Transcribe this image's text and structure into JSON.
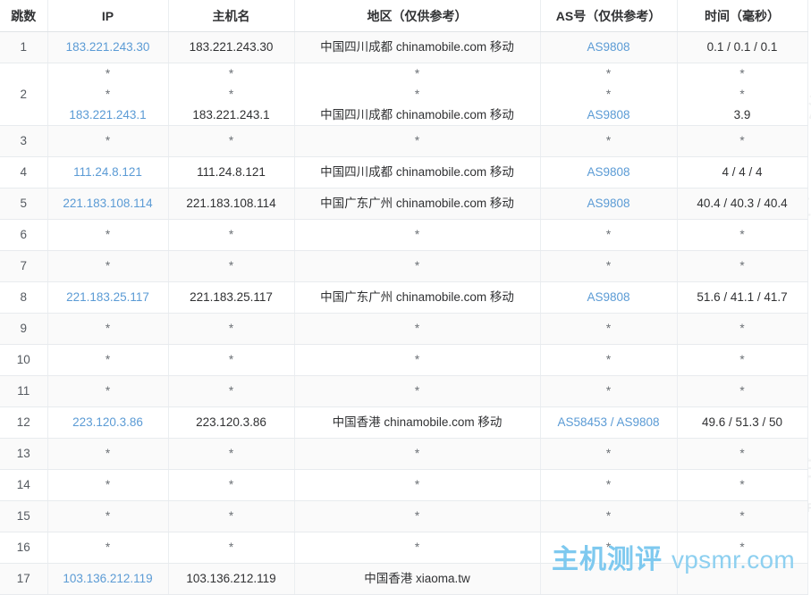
{
  "table": {
    "headers": [
      "跳数",
      "IP",
      "主机名",
      "地区（仅供参考）",
      "AS号（仅供参考）",
      "时间（毫秒）"
    ],
    "star": "*",
    "rows": [
      {
        "hop": "1",
        "ip": "183.221.243.30",
        "host": "183.221.243.30",
        "geo": "中国四川成都 chinamobile.com 移动",
        "as": "AS9808",
        "time": "0.1 / 0.1 / 0.1",
        "multiline": false
      },
      {
        "hop": "2",
        "ip": "183.221.243.1",
        "host": "183.221.243.1",
        "geo": "中国四川成都 chinamobile.com 移动",
        "as": "AS9808",
        "time": "3.9",
        "multiline": true
      },
      {
        "hop": "3",
        "ip": "*",
        "host": "*",
        "geo": "*",
        "as": "*",
        "time": "*",
        "multiline": false
      },
      {
        "hop": "4",
        "ip": "111.24.8.121",
        "host": "111.24.8.121",
        "geo": "中国四川成都 chinamobile.com 移动",
        "as": "AS9808",
        "time": "4 / 4 / 4",
        "multiline": false
      },
      {
        "hop": "5",
        "ip": "221.183.108.114",
        "host": "221.183.108.114",
        "geo": "中国广东广州 chinamobile.com 移动",
        "as": "AS9808",
        "time": "40.4 / 40.3 / 40.4",
        "multiline": false
      },
      {
        "hop": "6",
        "ip": "*",
        "host": "*",
        "geo": "*",
        "as": "*",
        "time": "*",
        "multiline": false
      },
      {
        "hop": "7",
        "ip": "*",
        "host": "*",
        "geo": "*",
        "as": "*",
        "time": "*",
        "multiline": false
      },
      {
        "hop": "8",
        "ip": "221.183.25.117",
        "host": "221.183.25.117",
        "geo": "中国广东广州 chinamobile.com 移动",
        "as": "AS9808",
        "time": "51.6 / 41.1 / 41.7",
        "multiline": false
      },
      {
        "hop": "9",
        "ip": "*",
        "host": "*",
        "geo": "*",
        "as": "*",
        "time": "*",
        "multiline": false
      },
      {
        "hop": "10",
        "ip": "*",
        "host": "*",
        "geo": "*",
        "as": "*",
        "time": "*",
        "multiline": false
      },
      {
        "hop": "11",
        "ip": "*",
        "host": "*",
        "geo": "*",
        "as": "*",
        "time": "*",
        "multiline": false
      },
      {
        "hop": "12",
        "ip": "223.120.3.86",
        "host": "223.120.3.86",
        "geo": "中国香港 chinamobile.com 移动",
        "as": "AS58453 / AS9808",
        "time": "49.6 / 51.3 / 50",
        "multiline": false
      },
      {
        "hop": "13",
        "ip": "*",
        "host": "*",
        "geo": "*",
        "as": "*",
        "time": "*",
        "multiline": false
      },
      {
        "hop": "14",
        "ip": "*",
        "host": "*",
        "geo": "*",
        "as": "*",
        "time": "*",
        "multiline": false
      },
      {
        "hop": "15",
        "ip": "*",
        "host": "*",
        "geo": "*",
        "as": "*",
        "time": "*",
        "multiline": false
      },
      {
        "hop": "16",
        "ip": "*",
        "host": "*",
        "geo": "*",
        "as": "*",
        "time": "*",
        "multiline": false
      },
      {
        "hop": "17",
        "ip": "103.136.212.119",
        "host": "103.136.212.119",
        "geo": "中国香港 xiaoma.tw",
        "as": "",
        "time": "",
        "multiline": false
      }
    ]
  },
  "brand": {
    "name_cn": "主机测评",
    "url": "vpsmr.com",
    "color": "#7ec9ef"
  },
  "watermark": {
    "name_cn": "主机测评",
    "url": "VPSMR.COM",
    "color": "#d6d8da"
  },
  "colors": {
    "link": "#5b9bd5",
    "text": "#303133",
    "stripe": "#fafafa",
    "border": "#ebeef1"
  }
}
